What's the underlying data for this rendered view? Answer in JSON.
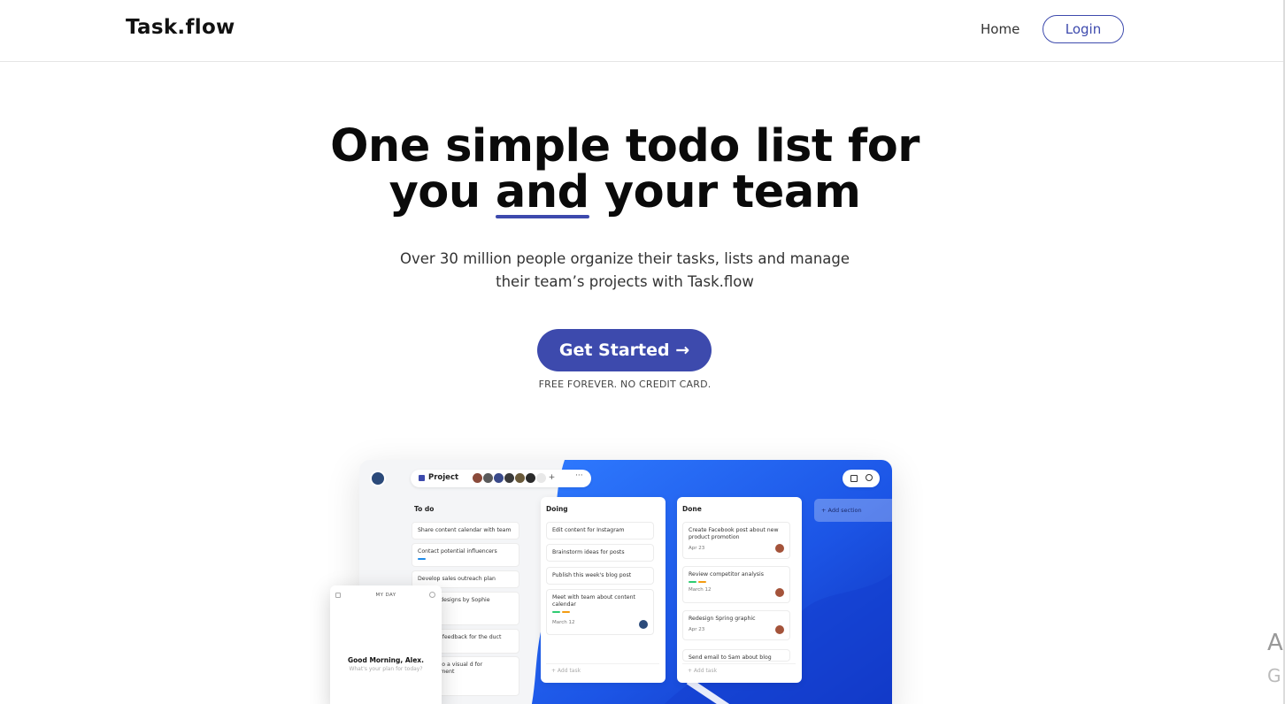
{
  "nav": {
    "logo": "Task.flow",
    "home": "Home",
    "login": "Login"
  },
  "hero": {
    "title_line1": "One simple todo list for",
    "title_line2_pre": "you ",
    "title_highlight": "and",
    "title_line2_post": " your team",
    "subtitle_line1": "Over 30 million people organize their tasks, lists and manage",
    "subtitle_line2": "their team’s projects with Task.flow",
    "cta": "Get Started →",
    "cta_note": "FREE FOREVER. NO CREDIT CARD."
  },
  "mockup": {
    "project_label": "Project",
    "project_more": "···",
    "add_section": "+  Add section",
    "columns": {
      "todo": {
        "title": "To do",
        "cards": [
          "Share content calendar with team",
          "Contact potential influencers",
          "Develop sales outreach plan",
          "ne card designs by Sophie",
          "ustomer feedback for the duct direction",
          "sheet into a visual d for management"
        ]
      },
      "doing": {
        "title": "Doing",
        "cards": [
          "Edit content for Instagram",
          "Brainstorm ideas for posts",
          "Publish this week's blog post",
          "Meet with team about content calendar"
        ],
        "card_date": "March 12",
        "add_task": "+   Add task"
      },
      "done": {
        "title": "Done",
        "cards": [
          "Create Facebook post about new product promotion",
          "Review competitor analysis",
          "Redesign Spring graphic",
          "Send email to Sam about blog"
        ],
        "dates": [
          "Apr 23",
          "March 12",
          "Apr 23"
        ],
        "add_task": "+   Add task"
      }
    },
    "my_day": {
      "title": "MY DAY",
      "greeting": "Good Morning, Alex.",
      "question": "What's your plan for today?"
    }
  },
  "edge_text": {
    "a": "A",
    "g": "G"
  },
  "colors": {
    "brand": "#3d4aad",
    "blob": "#1f63f0"
  }
}
